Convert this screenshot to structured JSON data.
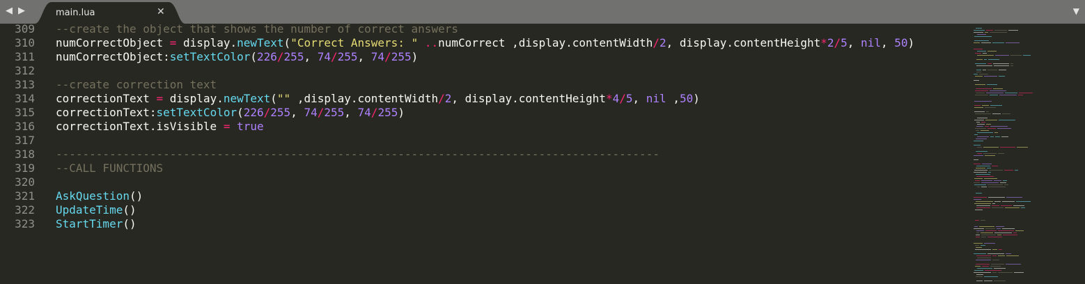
{
  "nav": {
    "back_icon": "◀",
    "forward_icon": "▶"
  },
  "tab": {
    "label": "main.lua",
    "close_icon": "✕"
  },
  "dropdown_icon": "▼",
  "colors": {
    "background": "#272822",
    "tabbar": "#717170",
    "text": "#f8f8f2",
    "comment": "#75715e",
    "string": "#e6db74",
    "number": "#ae81ff",
    "operator": "#f92672",
    "function": "#66d9ef",
    "line_number": "#90908a"
  },
  "lines": [
    {
      "num": "309",
      "tokens": [
        {
          "t": "--create the object that shows the number of correct answers",
          "c": "cm"
        }
      ]
    },
    {
      "num": "310",
      "tokens": [
        {
          "t": "numCorrectObject ",
          "c": ""
        },
        {
          "t": "=",
          "c": "op"
        },
        {
          "t": " display.",
          "c": ""
        },
        {
          "t": "newText",
          "c": "fn"
        },
        {
          "t": "(",
          "c": ""
        },
        {
          "t": "\"Correct Answers: \"",
          "c": "str"
        },
        {
          "t": " ",
          "c": ""
        },
        {
          "t": "..",
          "c": "op"
        },
        {
          "t": "numCorrect ,display.contentWidth",
          "c": ""
        },
        {
          "t": "/",
          "c": "op"
        },
        {
          "t": "2",
          "c": "num"
        },
        {
          "t": ", display.contentHeight",
          "c": ""
        },
        {
          "t": "*",
          "c": "op"
        },
        {
          "t": "2",
          "c": "num"
        },
        {
          "t": "/",
          "c": "op"
        },
        {
          "t": "5",
          "c": "num"
        },
        {
          "t": ", ",
          "c": ""
        },
        {
          "t": "nil",
          "c": "const"
        },
        {
          "t": ", ",
          "c": ""
        },
        {
          "t": "50",
          "c": "num"
        },
        {
          "t": ")",
          "c": ""
        }
      ]
    },
    {
      "num": "311",
      "tokens": [
        {
          "t": "numCorrectObject:",
          "c": ""
        },
        {
          "t": "setTextColor",
          "c": "fn"
        },
        {
          "t": "(",
          "c": ""
        },
        {
          "t": "226",
          "c": "num"
        },
        {
          "t": "/",
          "c": "op"
        },
        {
          "t": "255",
          "c": "num"
        },
        {
          "t": ", ",
          "c": ""
        },
        {
          "t": "74",
          "c": "num"
        },
        {
          "t": "/",
          "c": "op"
        },
        {
          "t": "255",
          "c": "num"
        },
        {
          "t": ", ",
          "c": ""
        },
        {
          "t": "74",
          "c": "num"
        },
        {
          "t": "/",
          "c": "op"
        },
        {
          "t": "255",
          "c": "num"
        },
        {
          "t": ")",
          "c": ""
        }
      ]
    },
    {
      "num": "312",
      "tokens": []
    },
    {
      "num": "313",
      "tokens": [
        {
          "t": "--create correction text",
          "c": "cm"
        }
      ]
    },
    {
      "num": "314",
      "tokens": [
        {
          "t": "correctionText ",
          "c": ""
        },
        {
          "t": "=",
          "c": "op"
        },
        {
          "t": " display.",
          "c": ""
        },
        {
          "t": "newText",
          "c": "fn"
        },
        {
          "t": "(",
          "c": ""
        },
        {
          "t": "\"\"",
          "c": "str"
        },
        {
          "t": " ,display.contentWidth",
          "c": ""
        },
        {
          "t": "/",
          "c": "op"
        },
        {
          "t": "2",
          "c": "num"
        },
        {
          "t": ", display.contentHeight",
          "c": ""
        },
        {
          "t": "*",
          "c": "op"
        },
        {
          "t": "4",
          "c": "num"
        },
        {
          "t": "/",
          "c": "op"
        },
        {
          "t": "5",
          "c": "num"
        },
        {
          "t": ", ",
          "c": ""
        },
        {
          "t": "nil",
          "c": "const"
        },
        {
          "t": " ,",
          "c": ""
        },
        {
          "t": "50",
          "c": "num"
        },
        {
          "t": ")",
          "c": ""
        }
      ]
    },
    {
      "num": "315",
      "tokens": [
        {
          "t": "correctionText:",
          "c": ""
        },
        {
          "t": "setTextColor",
          "c": "fn"
        },
        {
          "t": "(",
          "c": ""
        },
        {
          "t": "226",
          "c": "num"
        },
        {
          "t": "/",
          "c": "op"
        },
        {
          "t": "255",
          "c": "num"
        },
        {
          "t": ", ",
          "c": ""
        },
        {
          "t": "74",
          "c": "num"
        },
        {
          "t": "/",
          "c": "op"
        },
        {
          "t": "255",
          "c": "num"
        },
        {
          "t": ", ",
          "c": ""
        },
        {
          "t": "74",
          "c": "num"
        },
        {
          "t": "/",
          "c": "op"
        },
        {
          "t": "255",
          "c": "num"
        },
        {
          "t": ")",
          "c": ""
        }
      ]
    },
    {
      "num": "316",
      "tokens": [
        {
          "t": "correctionText.isVisible ",
          "c": ""
        },
        {
          "t": "=",
          "c": "op"
        },
        {
          "t": " ",
          "c": ""
        },
        {
          "t": "true",
          "c": "const"
        }
      ]
    },
    {
      "num": "317",
      "tokens": []
    },
    {
      "num": "318",
      "tokens": [
        {
          "t": "------------------------------------------------------------------------------------------",
          "c": "cm"
        }
      ]
    },
    {
      "num": "319",
      "tokens": [
        {
          "t": "--CALL FUNCTIONS",
          "c": "cm"
        }
      ]
    },
    {
      "num": "320",
      "tokens": []
    },
    {
      "num": "321",
      "tokens": [
        {
          "t": "AskQuestion",
          "c": "fn"
        },
        {
          "t": "()",
          "c": ""
        }
      ]
    },
    {
      "num": "322",
      "tokens": [
        {
          "t": "UpdateTime",
          "c": "fn"
        },
        {
          "t": "()",
          "c": ""
        }
      ]
    },
    {
      "num": "323",
      "tokens": [
        {
          "t": "StartTimer",
          "c": "fn"
        },
        {
          "t": "()",
          "c": ""
        }
      ]
    }
  ]
}
